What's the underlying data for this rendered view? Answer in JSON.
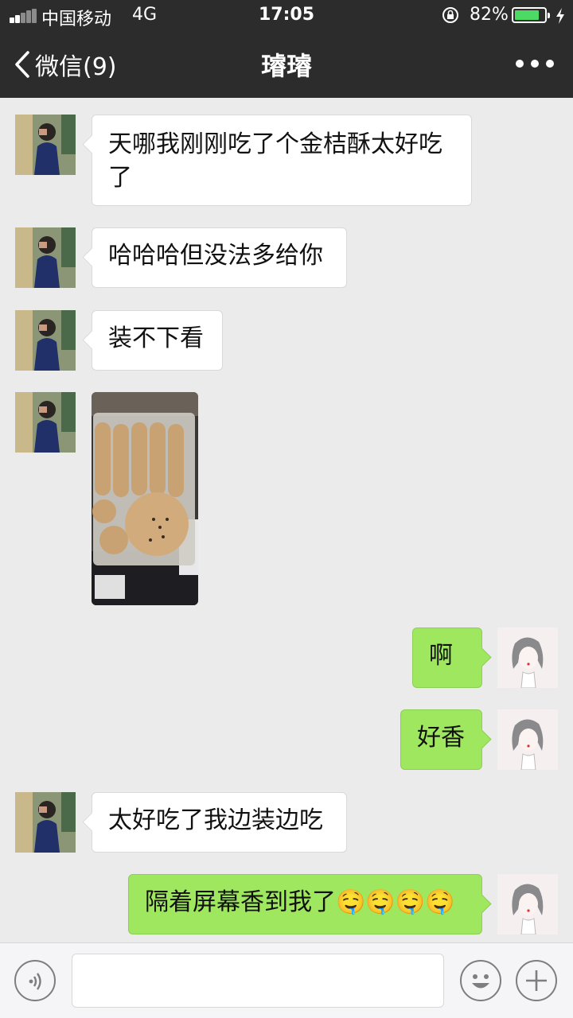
{
  "status_bar": {
    "carrier": "中国移动",
    "network": "4G",
    "time": "17:05",
    "battery_percent": "82%",
    "battery_level": 0.82
  },
  "header": {
    "back_label": "微信(9)",
    "title": "璿璿",
    "more_icon": "more-dots-icon"
  },
  "messages": [
    {
      "side": "in",
      "text": "天哪我刚刚吃了个金桔酥太好吃了"
    },
    {
      "side": "in",
      "text": "哈哈哈但没法多给你"
    },
    {
      "side": "in",
      "text": "装不下看"
    },
    {
      "side": "in",
      "type": "image"
    },
    {
      "side": "out",
      "text": "啊"
    },
    {
      "side": "out",
      "text": "好香"
    },
    {
      "side": "in",
      "text": "太好吃了我边装边吃"
    },
    {
      "side": "out",
      "text": "隔着屏幕香到我了🤤🤤🤤🤤"
    }
  ],
  "input_bar": {
    "voice_icon": "voice-icon",
    "emoji_icon": "emoji-icon",
    "plus_icon": "plus-icon"
  },
  "colors": {
    "header_bg": "#2c2c2c",
    "chat_bg": "#ebebeb",
    "out_bubble": "#9fe75f",
    "in_bubble": "#ffffff",
    "battery": "#4cd964"
  }
}
